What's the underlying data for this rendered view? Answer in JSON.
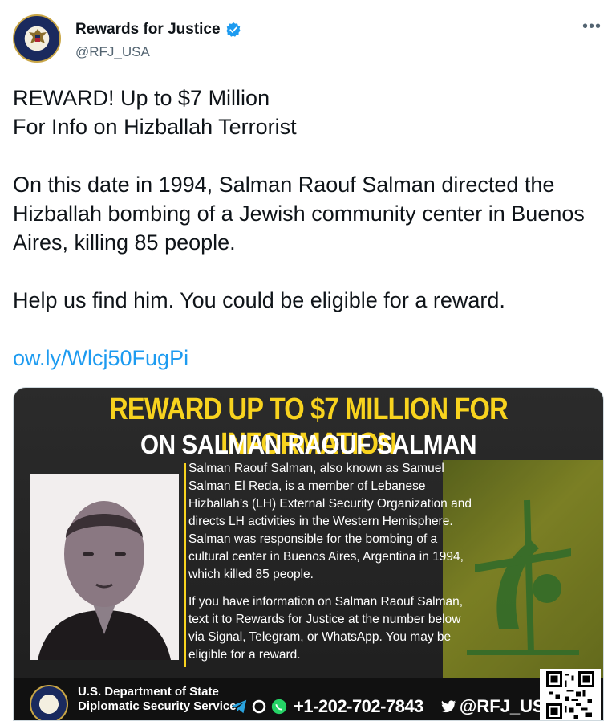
{
  "account": {
    "name": "Rewards for Justice",
    "handle": "@RFJ_USA",
    "verified": true,
    "avatar_icon": "us-dept-of-state-seal-icon",
    "more_label": "•••"
  },
  "tweet": {
    "paragraphs": [
      "REWARD! Up to $7 Million\nFor Info on Hizballah Terrorist",
      "On this date in 1994, Salman Raouf Salman directed the Hizballah bombing of a Jewish community center in Buenos Aires, killing 85 people.",
      "Help us find him. You could be eligible for a reward."
    ],
    "link": "ow.ly/Wlcj50FugPi"
  },
  "poster": {
    "headline": "REWARD UP TO $7 MILLION FOR INFORMATION",
    "subheadline": "ON SALMAN RAOUF SALMAN",
    "bio_paragraphs": [
      "Salman Raouf Salman, also known as Samuel Salman El Reda, is a member of Lebanese Hizballah’s (LH) External Security Organization and directs LH activities in the Western Hemisphere. Salman was responsible for the bombing of a cultural center in Buenos Aires, Argentina in 1994, which killed 85 people.",
      "If you have information on Salman Raouf Salman, text it to Rewards for Justice at the number below via Signal, Telegram, or WhatsApp. You may be eligible for a reward."
    ],
    "department_line1": "U.S. Department of State",
    "department_line2": "Diplomatic Security Service",
    "phone": "+1-202-702-7843",
    "twitter_handle": "@RFJ_USA",
    "colors": {
      "headline": "#f8d31e",
      "background": "#222222",
      "flag": "#7d8420",
      "link": "#1d9bf0"
    }
  }
}
